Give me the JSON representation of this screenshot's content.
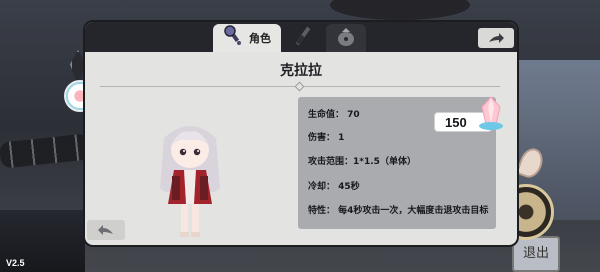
{
  "version": "V2.5",
  "tabs": {
    "active_label": "角色"
  },
  "character": {
    "name": "克拉拉",
    "stats": [
      {
        "label": "生命值",
        "value": "70"
      },
      {
        "label": "伤害",
        "value": "1"
      },
      {
        "label": "攻击范围",
        "value": "1*1.5（单体）"
      },
      {
        "label": "冷却",
        "value": "45秒"
      },
      {
        "label": "特性",
        "value": "每4秒攻击一次，大幅度击退攻击目标"
      }
    ],
    "cost": "150"
  },
  "background": {
    "exit_sign": "退出"
  },
  "icons": {
    "tab_1": "wrench-tool-icon",
    "tab_2": "knife-tool-icon",
    "tab_3": "bomb-bag-icon",
    "share": "share-arrow-icon",
    "back": "back-arrow-icon",
    "cost": "crystal-icon"
  },
  "colors": {
    "panel": "#e3e4e1",
    "stats_box": "#aaabae",
    "tabbar": "#25262b",
    "accent_crystal": "#ffb7c8"
  }
}
